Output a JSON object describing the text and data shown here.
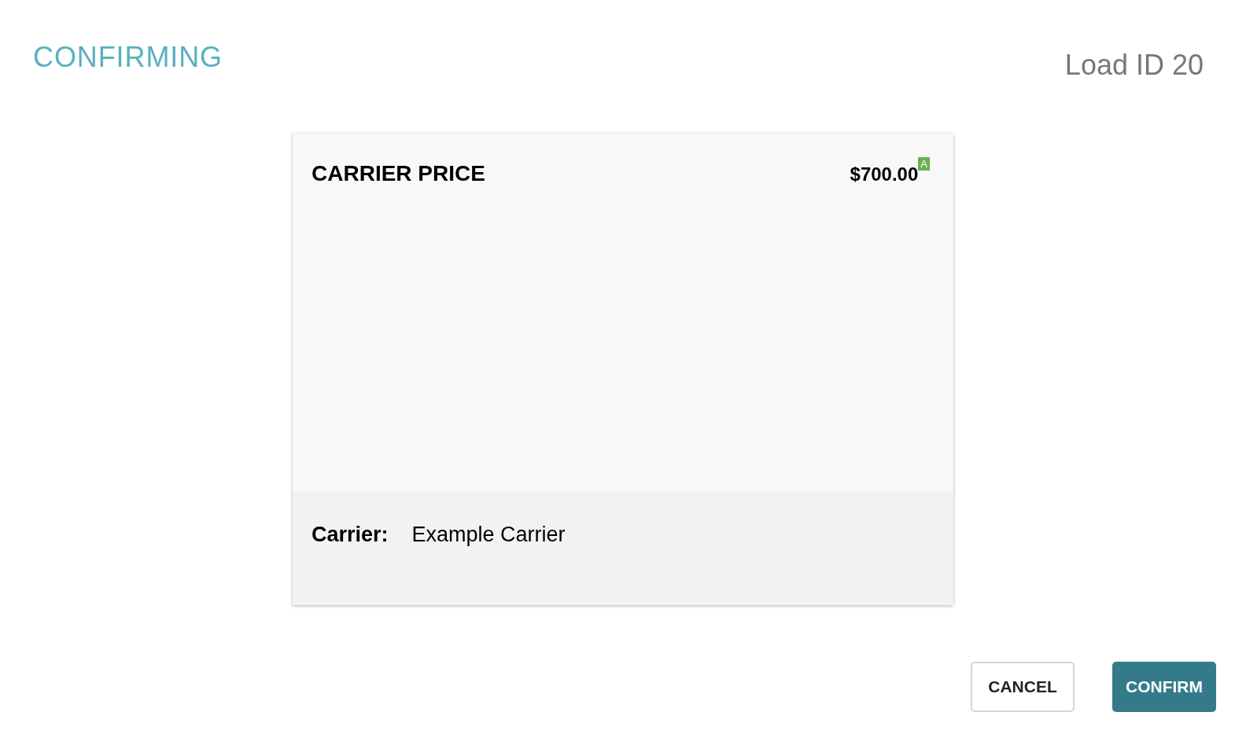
{
  "header": {
    "title": "CONFIRMING",
    "load_id": "Load ID 20"
  },
  "card": {
    "heading": "CARRIER PRICE",
    "price": "$700.00",
    "price_badge": "A",
    "footer": {
      "label": "Carrier:",
      "value": "Example Carrier"
    }
  },
  "buttons": [
    {
      "label": "CANCEL",
      "kind": "secondary"
    },
    {
      "label": "CONFIRM",
      "kind": "primary"
    }
  ]
}
